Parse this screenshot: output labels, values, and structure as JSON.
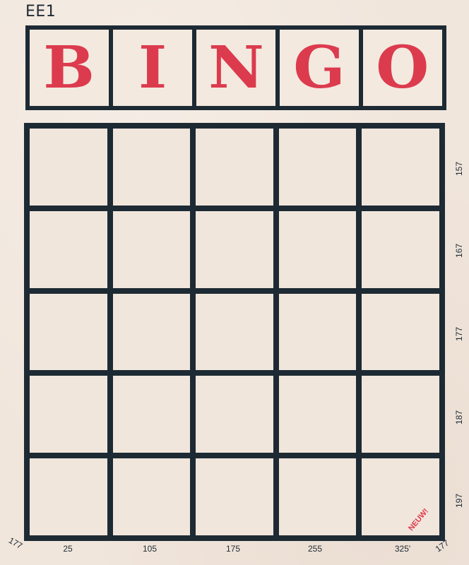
{
  "card_code": "EE1",
  "header_letters": [
    "B",
    "I",
    "N",
    "G",
    "O"
  ],
  "row_numbers": [
    "157",
    "167",
    "177",
    "187",
    "197"
  ],
  "column_numbers": [
    "25",
    "105",
    "175",
    "255",
    "325'"
  ],
  "corner_left": "177",
  "corner_right": "177",
  "stamp": "NEUW!",
  "colors": {
    "background": "#f1e6dc",
    "ink": "#1d2a34",
    "letters": "#dc3b4e"
  }
}
